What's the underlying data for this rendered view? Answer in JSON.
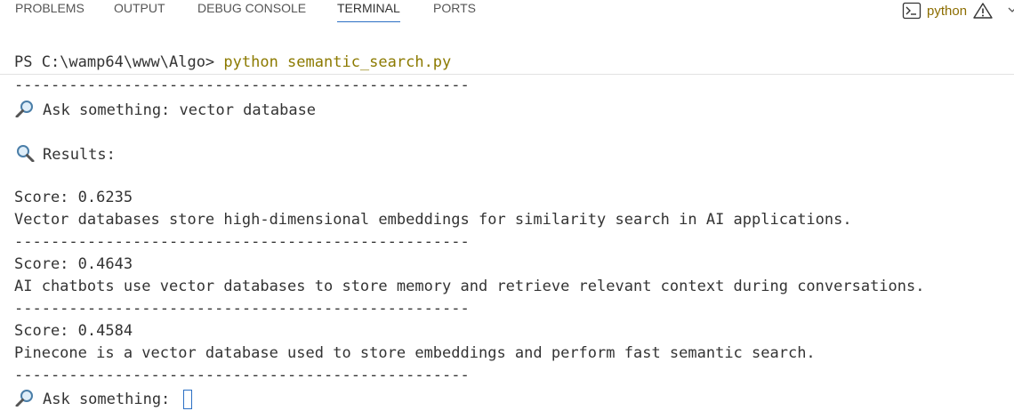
{
  "panel": {
    "tabs": [
      {
        "label": "PROBLEMS"
      },
      {
        "label": "OUTPUT"
      },
      {
        "label": "DEBUG CONSOLE"
      },
      {
        "label": "TERMINAL",
        "active": true
      },
      {
        "label": "PORTS"
      }
    ],
    "terminal_name": "python",
    "icons": [
      "terminal-icon",
      "warning-icon",
      "chevron-down-icon"
    ],
    "colors": {
      "accent": "#2b6fc4",
      "terminal_name": "#8c6d00",
      "command": "#8c7a00"
    }
  },
  "terminal": {
    "prompt": "PS C:\\wamp64\\www\\Algo> ",
    "command": "python semantic_search.py",
    "separator": "--------------------------------------------------",
    "query_label": "Ask something: vector database",
    "results_label": "Results:",
    "results": [
      {
        "score": "Score: 0.6235",
        "text": "Vector databases store high-dimensional embeddings for similarity search in AI applications."
      },
      {
        "score": "Score: 0.4643",
        "text": "AI chatbots use vector databases to store memory and retrieve relevant context during conversations."
      },
      {
        "score": "Score: 0.4584",
        "text": "Pinecone is a vector database used to store embeddings and perform fast semantic search."
      }
    ],
    "next_prompt": "Ask something: ",
    "emoji_icons": [
      "magnifier-left-icon",
      "magnifier-right-icon"
    ]
  }
}
